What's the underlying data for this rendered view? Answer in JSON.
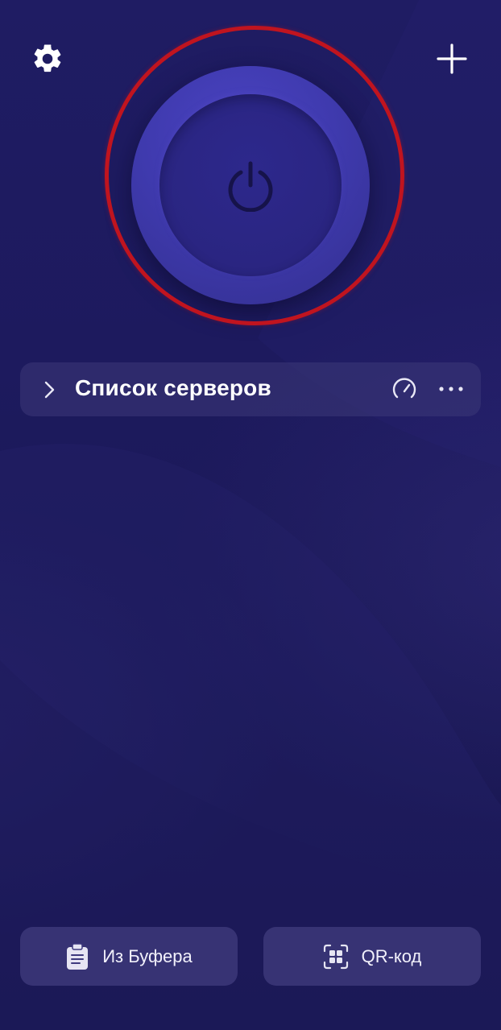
{
  "server_list": {
    "title": "Список серверов"
  },
  "bottom_actions": {
    "clipboard_label": "Из Буфера",
    "qr_label": "QR-код"
  },
  "icons": {
    "settings": "gear-icon",
    "add": "plus-icon",
    "power": "power-icon",
    "expand": "chevron-right-icon",
    "speed_test": "speedometer-icon",
    "more": "more-horizontal-icon",
    "clipboard": "clipboard-icon",
    "qr": "qr-code-scan-icon"
  },
  "colors": {
    "background": "#1d1a5e",
    "power_outer": "#4a43c2",
    "power_inner": "#2a2581",
    "highlight_ring": "#c0141f",
    "panel": "#3c3878"
  }
}
